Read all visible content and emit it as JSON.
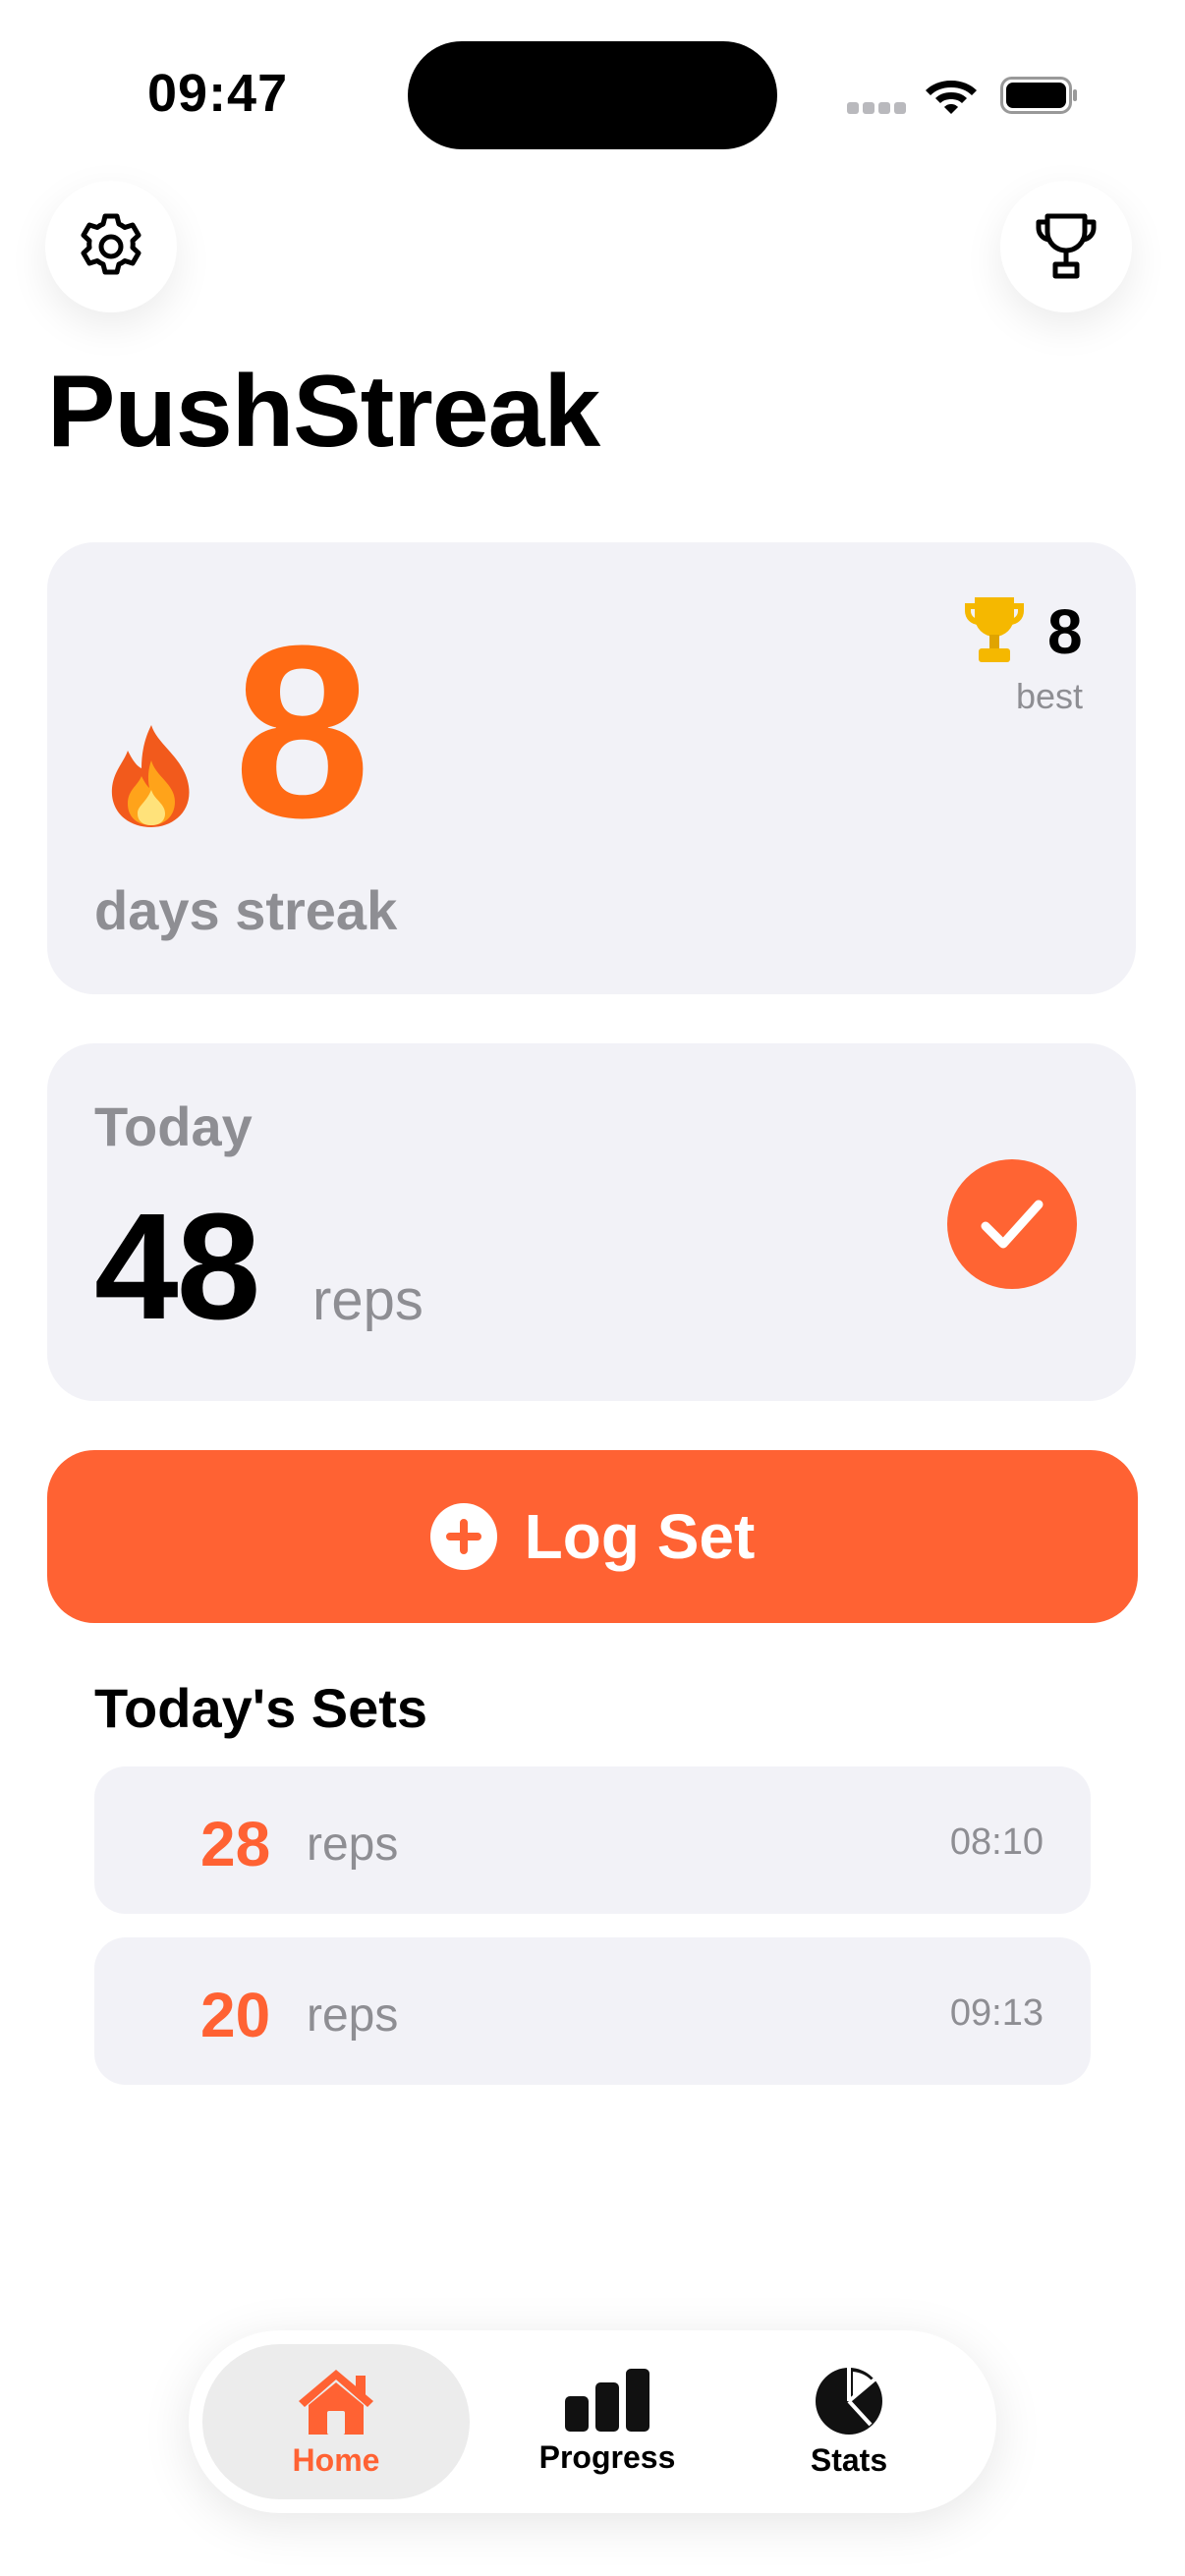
{
  "status_bar": {
    "time": "09:47"
  },
  "app": {
    "title": "PushStreak"
  },
  "streak": {
    "value": "8",
    "label": "days streak",
    "best_value": "8",
    "best_label": "best"
  },
  "today": {
    "label": "Today",
    "reps": "48",
    "unit": "reps",
    "goal_met": true
  },
  "actions": {
    "log_set_label": "Log Set"
  },
  "sets": {
    "title": "Today's Sets",
    "items": [
      {
        "reps": "28",
        "unit": "reps",
        "time": "08:10"
      },
      {
        "reps": "20",
        "unit": "reps",
        "time": "09:13"
      }
    ]
  },
  "tabs": [
    {
      "label": "Home",
      "icon": "home-icon",
      "active": true
    },
    {
      "label": "Progress",
      "icon": "bar-chart-icon",
      "active": false
    },
    {
      "label": "Stats",
      "icon": "pie-chart-icon",
      "active": false
    }
  ],
  "colors": {
    "accent": "#FF6233",
    "streak_orange": "#FF6A14",
    "card_bg": "#F2F2F7",
    "secondary_text": "#8E8E93",
    "trophy_gold": "#F5B800"
  }
}
